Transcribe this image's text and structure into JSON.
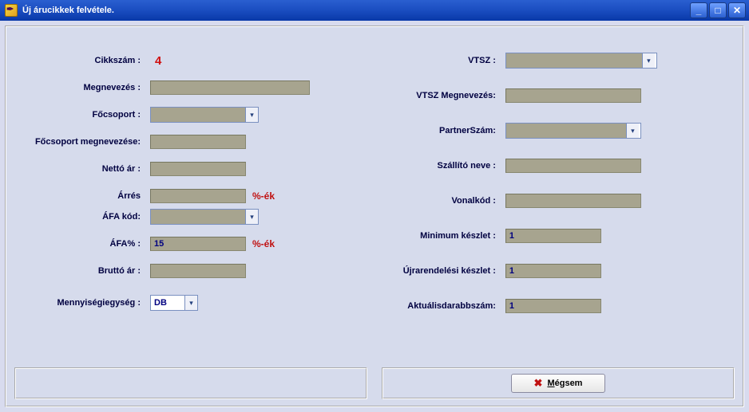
{
  "window": {
    "title": "Új árucikkek felvétele."
  },
  "left": {
    "cikkszam_label": "Cikkszám :",
    "cikkszam_value": "4",
    "megnevezes_label": "Megnevezés :",
    "megnevezes_value": "",
    "focsoport_label": "Főcsoport :",
    "focsoport_value": "",
    "focsoport_megn_label": "Főcsoport megnevezése:",
    "focsoport_megn_value": "",
    "nettoar_label": "Nettó ár :",
    "nettoar_value": "",
    "arres_label": "Árrés",
    "arres_value": "",
    "arres_suffix": "%-ék",
    "afakod_label": "ÁFA kód:",
    "afakod_value": "",
    "afapct_label": "ÁFA%  :",
    "afapct_value": "15",
    "afapct_suffix": "%-ék",
    "brutto_label": "Bruttó ár :",
    "brutto_value": "",
    "menny_label": "Mennyiségiegység :",
    "menny_value": "DB"
  },
  "right": {
    "vtsz_label": "VTSZ :",
    "vtsz_value": "",
    "vtsz_megn_label": "VTSZ Megnevezés:",
    "vtsz_megn_value": "",
    "partner_label": "PartnerSzám:",
    "partner_value": "",
    "szallito_label": "Szállító neve :",
    "szallito_value": "",
    "vonalkod_label": "Vonalkód :",
    "vonalkod_value": "",
    "minkeszlet_label": "Minimum készlet :",
    "minkeszlet_value": "1",
    "ujrarend_label": "Újrarendelési készlet :",
    "ujrarend_value": "1",
    "aktualis_label": "Aktuálisdarabbszám:",
    "aktualis_value": "1"
  },
  "buttons": {
    "cancel_firstchar": "M",
    "cancel_rest": "égsem"
  }
}
